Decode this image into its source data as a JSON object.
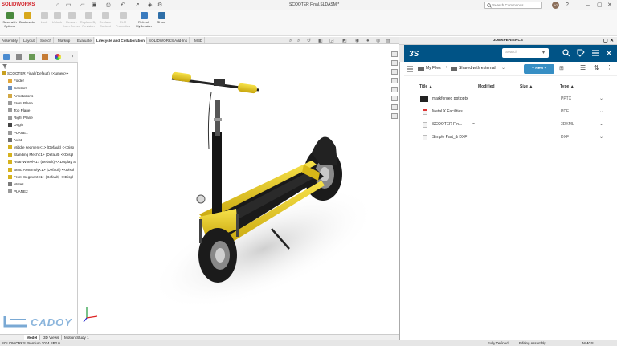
{
  "titlebar": {
    "app": "SOLIDWORKS",
    "document": "SCOOTER Final.SLDASM *",
    "search_placeholder": "Search Commands",
    "avatar": "AG"
  },
  "ribbon": {
    "buttons": [
      {
        "label": "Save with Options",
        "disabled": false
      },
      {
        "label": "Bookmarks",
        "disabled": false
      },
      {
        "label": "Lock",
        "disabled": true
      },
      {
        "label": "Unlock",
        "disabled": true
      },
      {
        "label": "Restore from Server",
        "disabled": true
      },
      {
        "label": "Replace By Revision",
        "disabled": true
      },
      {
        "label": "Replace Content",
        "disabled": true
      },
      {
        "label": "PLM Properties",
        "disabled": true
      },
      {
        "label": "Refresh MySession",
        "disabled": false
      },
      {
        "label": "Share",
        "disabled": false
      }
    ]
  },
  "tabs": [
    "Assembly",
    "Layout",
    "Sketch",
    "Markup",
    "Evaluate",
    "Lifecycle and Collaboration",
    "SOLIDWORKS Add-Ins",
    "MBD"
  ],
  "active_tab": "Lifecycle and Collaboration",
  "tree": [
    {
      "label": "SCOOTER Final (Default) <<umen>>",
      "indent": 0
    },
    {
      "label": "Folder",
      "indent": 1
    },
    {
      "label": "Sensors",
      "indent": 1
    },
    {
      "label": "Annotations",
      "indent": 1
    },
    {
      "label": "Front Plane",
      "indent": 1
    },
    {
      "label": "Top Plane",
      "indent": 1
    },
    {
      "label": "Right Plane",
      "indent": 1
    },
    {
      "label": "Origin",
      "indent": 1
    },
    {
      "label": "PLANE1",
      "indent": 1
    },
    {
      "label": "Axis1",
      "indent": 1
    },
    {
      "label": "Middle segment<1> (Default) <<Disp",
      "indent": 1
    },
    {
      "label": "Standing Mech<1> (Default) <<Displ",
      "indent": 1
    },
    {
      "label": "Rear Wheel<1> (Default) <<Display S",
      "indent": 1
    },
    {
      "label": "Bend Assembly<1> (Default) <<Displ",
      "indent": 1
    },
    {
      "label": "Front Segment<1> (Default) <<Displ",
      "indent": 1
    },
    {
      "label": "Mates",
      "indent": 1
    },
    {
      "label": "PLANE2",
      "indent": 1
    }
  ],
  "bottom_tabs": [
    "Model",
    "3D Views",
    "Motion Study 1"
  ],
  "active_bottom_tab": "Model",
  "watermark": "CADOY",
  "status": {
    "left": "SOLIDWORKS Premium 2024 SP2.0",
    "defined": "Fully Defined",
    "mode": "Editing Assembly",
    "units": "MMGS"
  },
  "panel": {
    "title": "3DEXPERIENCE",
    "search_placeholder": "Search",
    "crumb_1": "My Files",
    "crumb_2": "Shared with external",
    "new_label": "New",
    "columns": {
      "title": "Title",
      "modified": "Modified",
      "size": "Size",
      "type": "Type"
    },
    "files": [
      {
        "name": "markforged ppt.pptx",
        "type": "PPTX",
        "icon": "image-thumb"
      },
      {
        "name": "Metal X Facilities ...",
        "type": "PDF",
        "icon": "pdf-icon"
      },
      {
        "name": "SCOOTER Fin...",
        "type": "3DXML",
        "icon": "3dxml-icon"
      },
      {
        "name": "Simple Part_& DXF",
        "type": "DXF",
        "icon": "dxf-icon"
      }
    ]
  },
  "colors": {
    "accent": "#005386",
    "new_button": "#368ec4",
    "scooter_yellow": "#f2d21b"
  }
}
